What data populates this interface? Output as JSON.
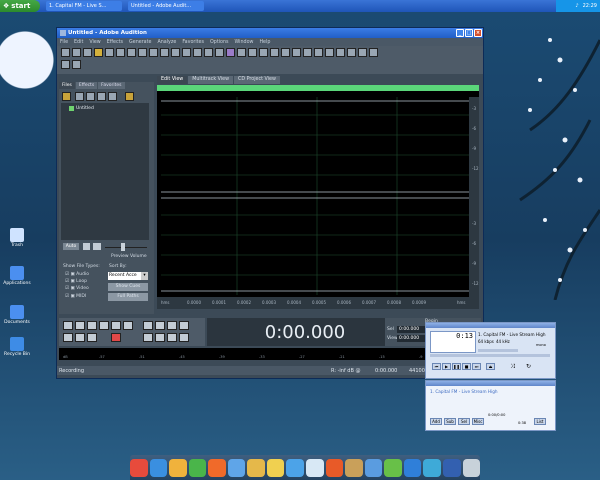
{
  "taskbar": {
    "start_label": "start",
    "items": [
      "1. Capital FM - Live S...",
      "Untitled - Adobe Audit..."
    ],
    "clock": "22:29"
  },
  "desktop_icons": [
    "Trash",
    "Applications",
    "Documents",
    "Recycle Bin"
  ],
  "window": {
    "title": "Untitled - Adobe Audition",
    "menu": [
      "File",
      "Edit",
      "View",
      "Effects",
      "Generate",
      "Analyze",
      "Favorites",
      "Options",
      "Window",
      "Help"
    ]
  },
  "files_panel": {
    "tabs": [
      "Files",
      "Effects",
      "Favorites"
    ],
    "file_name": "Untitled",
    "auto_label": "Auto",
    "preview_volume_label": "Preview Volume",
    "show_file_types_label": "Show File Types:",
    "file_types": [
      "Audio",
      "Loop",
      "Video",
      "MIDI"
    ],
    "sort_by_label": "Sort By:",
    "sort_value": "Recent Acce",
    "show_cues_label": "Show Cues",
    "full_paths_label": "Full Paths"
  },
  "main_tabs": [
    "Edit View",
    "Multitrack View",
    "CD Project View"
  ],
  "time_display": "0:00.000",
  "selection": {
    "begin_label": "Begin",
    "sel_label": "Sel",
    "view_label": "View",
    "sel_begin": "0:00.000",
    "view_begin": "0:00.000"
  },
  "status": {
    "left": "Recording",
    "level": "R: -inf dB @",
    "time": "0:00.000",
    "format": "44100 • 16-bit • Stereo"
  },
  "winamp": {
    "time": "0:13",
    "title": "1. Capital FM - Live Stream High",
    "kbps": "64 kbps",
    "khz": "44 kHz",
    "mono": "mono",
    "playlist_item": "1. Capital FM - Live Stream High",
    "playlist_buttons": [
      "Add",
      "Sub",
      "Sel",
      "Misc"
    ],
    "playlist_time": "0:00/0:00",
    "playlist_total": "0:38",
    "list_button": "List"
  },
  "colors": {
    "wave_bg": "#000000",
    "grid": "#1e4e2e",
    "accent": "#2a62c8"
  }
}
